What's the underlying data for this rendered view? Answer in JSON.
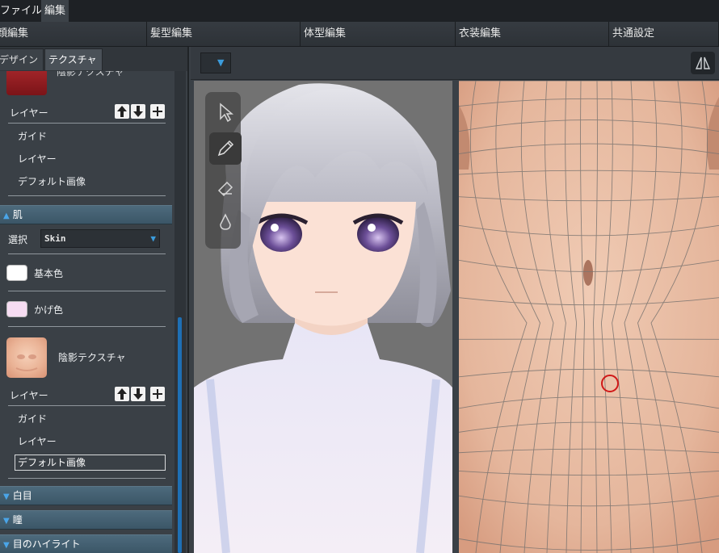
{
  "menu": {
    "file": "ファイル",
    "edit": "編集"
  },
  "main_tabs": [
    "顔編集",
    "髪型編集",
    "体型編集",
    "衣装編集",
    "共通設定"
  ],
  "sub_tabs": {
    "design": "デザイン",
    "texture": "テクスチャ"
  },
  "panel": {
    "top_texture_label": "陰影テクスチャ",
    "top_layer_label": "レイヤー",
    "top_items": [
      "ガイド",
      "レイヤー",
      "デフォルト画像"
    ],
    "skin_section": "肌",
    "select_label": "選択",
    "select_value": "Skin",
    "base_color_label": "基本色",
    "shadow_color_label": "かげ色",
    "shading_texture_label": "陰影テクスチャ",
    "layer_label": "レイヤー",
    "items": [
      "ガイド",
      "レイヤー"
    ],
    "default_image_value": "デフォルト画像",
    "collapsed_sections": [
      "白目",
      "瞳",
      "目のハイライト"
    ]
  },
  "colors": {
    "accent_blue": "#3b9cdc",
    "base_color_swatch": "#ffffff",
    "shadow_color_swatch": "#f6dcf2",
    "brush_marker": "#d01818",
    "skin": "#e7bda4"
  },
  "icons": {
    "tools": [
      "select-arrow-icon",
      "pen-icon",
      "eraser-icon",
      "eyedropper-icon"
    ],
    "mirror": "mirror-symmetry-icon",
    "layer_buttons": [
      "arrow-up-icon",
      "arrow-down-icon",
      "plus-icon"
    ]
  }
}
